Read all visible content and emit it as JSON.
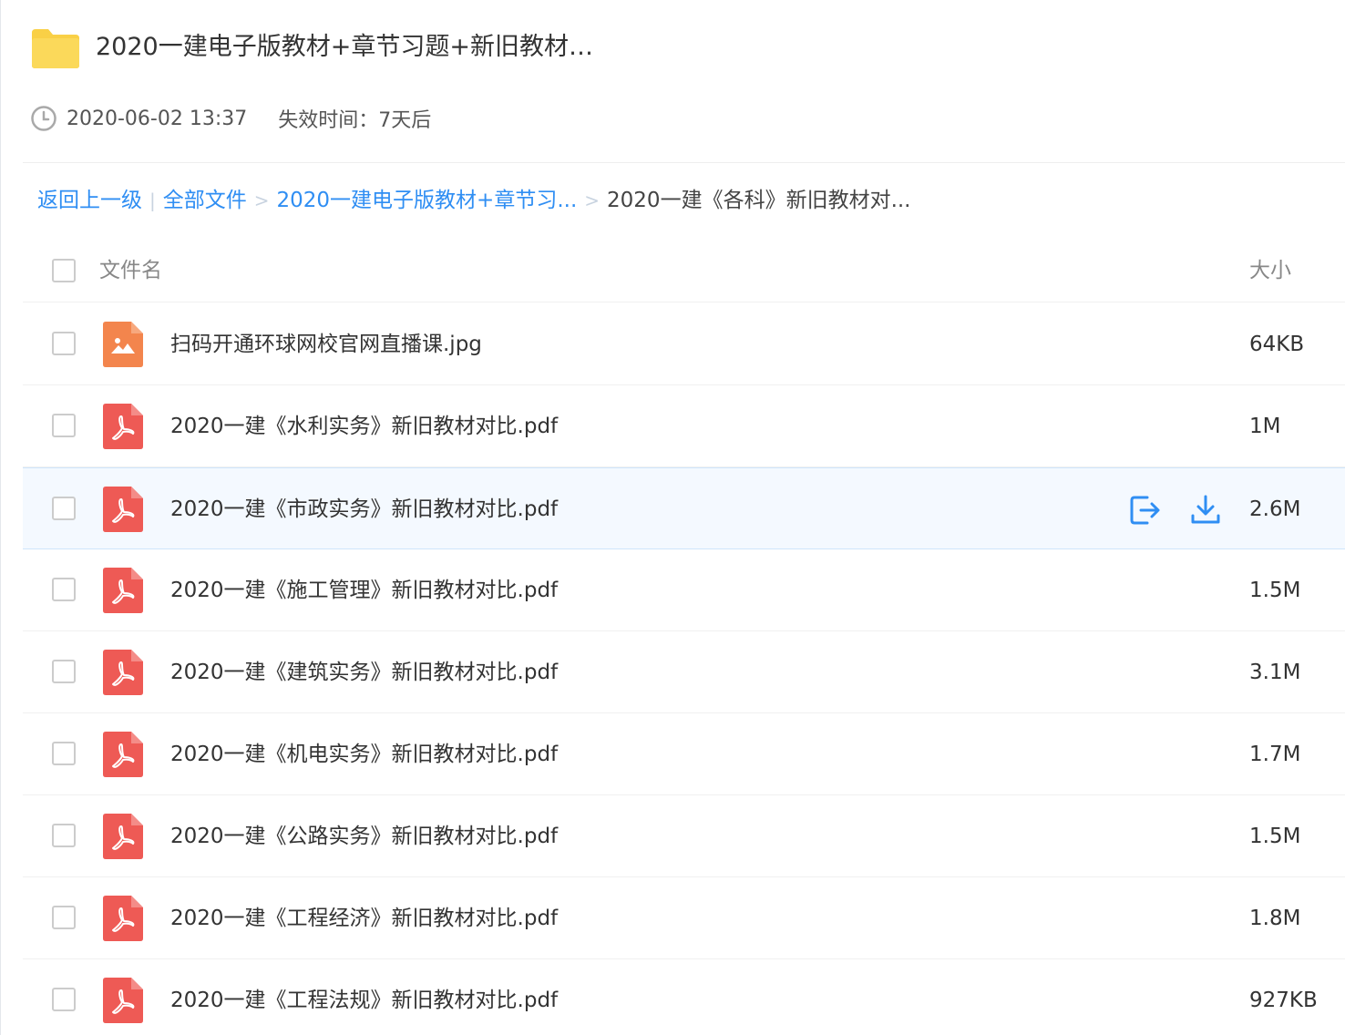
{
  "header": {
    "title": "2020一建电子版教材+章节习题+新旧教材…",
    "shared_time": "2020-06-02 13:37",
    "expiry_label": "失效时间：7天后",
    "folder_color": "#f9d046"
  },
  "breadcrumb": {
    "back": "返回上一级",
    "divider": "|",
    "all_files": "全部文件",
    "sep": ">",
    "parent": "2020一建电子版教材+章节习...",
    "current": "2020一建《各科》新旧教材对..."
  },
  "list_header": {
    "name": "文件名",
    "size": "大小"
  },
  "colors": {
    "link": "#2f8ef3",
    "pdf": "#ee5a55",
    "image": "#f3854d",
    "hover_bg": "#f4f9ff"
  },
  "files": [
    {
      "name": "扫码开通环球网校官网直播课.jpg",
      "size": "64KB",
      "icon": "image-file-icon"
    },
    {
      "name": "2020一建《水利实务》新旧教材对比.pdf",
      "size": "1M",
      "icon": "pdf-file-icon"
    },
    {
      "name": "2020一建《市政实务》新旧教材对比.pdf",
      "size": "2.6M",
      "icon": "pdf-file-icon"
    },
    {
      "name": "2020一建《施工管理》新旧教材对比.pdf",
      "size": "1.5M",
      "icon": "pdf-file-icon"
    },
    {
      "name": "2020一建《建筑实务》新旧教材对比.pdf",
      "size": "3.1M",
      "icon": "pdf-file-icon"
    },
    {
      "name": "2020一建《机电实务》新旧教材对比.pdf",
      "size": "1.7M",
      "icon": "pdf-file-icon"
    },
    {
      "name": "2020一建《公路实务》新旧教材对比.pdf",
      "size": "1.5M",
      "icon": "pdf-file-icon"
    },
    {
      "name": "2020一建《工程经济》新旧教材对比.pdf",
      "size": "1.8M",
      "icon": "pdf-file-icon"
    },
    {
      "name": "2020一建《工程法规》新旧教材对比.pdf",
      "size": "927KB",
      "icon": "pdf-file-icon"
    }
  ]
}
